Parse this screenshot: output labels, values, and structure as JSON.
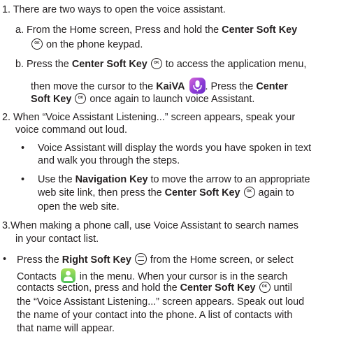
{
  "item1": {
    "num": "1.",
    "text": "There are two ways to open the voice assistant.",
    "a_marker": "a.",
    "a_pre": "From the Home screen, Press and hold the ",
    "a_bold": "Center Soft Key",
    "a_post": " on the phone keypad.",
    "b_marker": "b.",
    "b_pre": "Press the ",
    "b_bold1": "Center Soft Key",
    "b_mid1": " to access the application menu,",
    "b_line2_pre": "then move the cursor to the ",
    "b_bold2": "KaiVA",
    "b_mid2": ". Press the ",
    "b_bold3a": "Center",
    "b_bold3b": "Soft Key",
    "b_post": " once again to launch voice Assistant."
  },
  "item2": {
    "num": "2.",
    "line1": "When “Voice Assistant Listening...” screen appears, speak your",
    "line2": "voice command out loud.",
    "bullet1_line1": "Voice Assistant will display the words you have spoken in text",
    "bullet1_line2": "and walk you through the steps.",
    "bullet2_pre": "Use the ",
    "bullet2_bold": "Navigation Key",
    "bullet2_post": " to move the arrow to an appropriate",
    "bullet2_line2_pre": "web site link, then press the ",
    "bullet2_bold2": "Center Soft Key",
    "bullet2_line2_post": " again to",
    "bullet2_line3": "open the web site."
  },
  "item3": {
    "num": "3.",
    "line1": "When making a phone call, use Voice Assistant to search names",
    "line2": "in your contact list."
  },
  "last_bullet": {
    "l1_pre": "Press the ",
    "l1_bold": "Right Soft Key",
    "l1_post": " from the Home screen, or select",
    "l2_pre": "Contacts",
    "l2_post": " in the menu. When your cursor is in the search",
    "l3_pre": "contacts section, press and hold the ",
    "l3_bold": "Center Soft Key",
    "l3_post": " until",
    "l4": "the “Voice Assistant Listening...” screen appears.  Speak out loud",
    "l5": "the name of your contact into the phone. A list of contacts with",
    "l6": "that name will appear."
  },
  "bullet_char": "•",
  "icons": {
    "center_soft_key": "ok-key-icon",
    "right_soft_key": "right-soft-key-icon",
    "kaiva": "kaiva-mic-icon",
    "contacts": "contacts-icon"
  },
  "colors": {
    "text": "#231f20",
    "kaiva": "#8c3bd6",
    "contacts": "#4cc05a"
  }
}
